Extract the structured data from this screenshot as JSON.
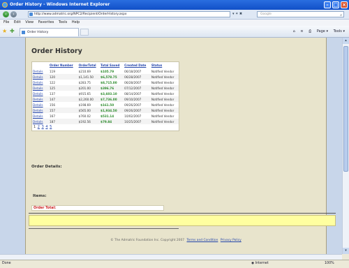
{
  "window": {
    "title": "Order History - Windows Internet Explorer"
  },
  "address": {
    "url": "http://www.admatric.org/NPC2/Recipient/OrderHistory.aspx",
    "search_placeholder": "Google",
    "buttons": "▾ ✶ ✖"
  },
  "menu": [
    "File",
    "Edit",
    "View",
    "Favorites",
    "Tools",
    "Help"
  ],
  "tab": {
    "label": "Order History"
  },
  "toolbar": {
    "page": "Page ▾",
    "tools": "Tools ▾"
  },
  "page": {
    "title": "Order History",
    "columns": [
      "",
      "Order Number",
      "OrderTotal",
      "Total Saved",
      "Created Date",
      "Status"
    ],
    "rows": [
      {
        "link": "Details",
        "num": "119",
        "total": "$210.69",
        "saved": "$105.79",
        "date": "06/18/2007",
        "status": "Notified Vendor"
      },
      {
        "link": "Details",
        "num": "120",
        "total": "$1,141.50",
        "saved": "$6,578.75",
        "date": "06/28/2007",
        "status": "Notified Vendor"
      },
      {
        "link": "Details",
        "num": "122",
        "total": "$283.75",
        "saved": "$8,715.00",
        "date": "06/28/2007",
        "status": "Notified Vendor"
      },
      {
        "link": "Details",
        "num": "125",
        "total": "$201.00",
        "saved": "$396.76",
        "date": "07/12/2007",
        "status": "Notified Vendor"
      },
      {
        "link": "Details",
        "num": "137",
        "total": "$915.65",
        "saved": "$3,603.10",
        "date": "08/14/2007",
        "status": "Notified Vendor"
      },
      {
        "link": "Details",
        "num": "147",
        "total": "$2,260.00",
        "saved": "$7,736.00",
        "date": "09/10/2007",
        "status": "Notified Vendor"
      },
      {
        "link": "Details",
        "num": "156",
        "total": "$198.69",
        "saved": "$161.50",
        "date": "09/26/2007",
        "status": "Notified Vendor"
      },
      {
        "link": "Details",
        "num": "157",
        "total": "$565.00",
        "saved": "$1,934.50",
        "date": "09/26/2007",
        "status": "Notified Vendor"
      },
      {
        "link": "Details",
        "num": "167",
        "total": "$760.02",
        "saved": "$531.14",
        "date": "10/02/2007",
        "status": "Notified Vendor"
      },
      {
        "link": "Details",
        "num": "187",
        "total": "$192.56",
        "saved": "$79.84",
        "date": "10/25/2007",
        "status": "Notified Vendor"
      }
    ],
    "pages": [
      "1",
      "2",
      "3",
      "4",
      "5"
    ],
    "order_details_label": "Order Details:",
    "items_label": "Items:",
    "order_total_label": "Order Total:",
    "footer_text": "© The Admatric Foundation Inc. Copyright 2007",
    "footer_terms": "Terms and Condition",
    "footer_privacy": "Privacy Policy"
  },
  "status": {
    "left": "Done",
    "zone": "Internet",
    "zoom": "100%"
  }
}
